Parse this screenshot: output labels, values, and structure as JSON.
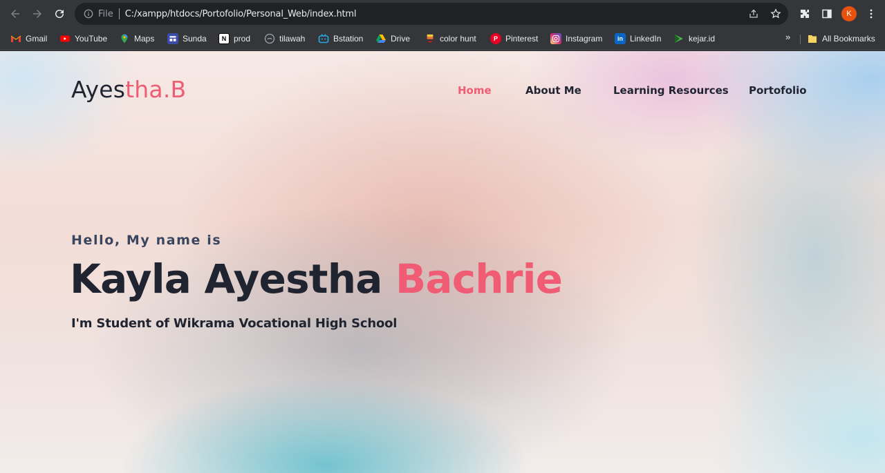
{
  "browser": {
    "omnibox": {
      "scheme_label": "File",
      "url": "C:/xampp/htdocs/Portofolio/Personal_Web/index.html"
    },
    "profile_initial": "K",
    "bookmarks": [
      {
        "label": "Gmail",
        "icon": "gmail-icon",
        "color": "#ea4335"
      },
      {
        "label": "YouTube",
        "icon": "youtube-icon",
        "color": "#ff0000"
      },
      {
        "label": "Maps",
        "icon": "maps-icon",
        "color": "#34a853"
      },
      {
        "label": "Sunda",
        "icon": "sunda-icon",
        "color": "#3b4ba8"
      },
      {
        "label": "prod",
        "icon": "notion-icon",
        "color": "#ffffff"
      },
      {
        "label": "tilawah",
        "icon": "tilawah-icon",
        "color": "#7a8a99"
      },
      {
        "label": "Bstation",
        "icon": "bstation-icon",
        "color": "#23ade5"
      },
      {
        "label": "Drive",
        "icon": "drive-icon",
        "color": "#fbbc04"
      },
      {
        "label": "color hunt",
        "icon": "colorhunt-icon",
        "color": "#f6c343"
      },
      {
        "label": "Pinterest",
        "icon": "pinterest-icon",
        "color": "#e60023"
      },
      {
        "label": "Instagram",
        "icon": "instagram-icon",
        "color": "#d62976"
      },
      {
        "label": "LinkedIn",
        "icon": "linkedin-icon",
        "color": "#0a66c2"
      },
      {
        "label": "kejar.id",
        "icon": "kejar-icon",
        "color": "#4caf50"
      }
    ],
    "more_bookmarks": "»",
    "all_bookmarks": "All Bookmarks"
  },
  "site": {
    "logo": {
      "part1": "Ayes",
      "part2": "tha.B"
    },
    "nav": [
      {
        "label": "Home",
        "active": true
      },
      {
        "label": "About Me",
        "active": false
      },
      {
        "label": "Learning Resources",
        "active": false
      },
      {
        "label": "Portofolio",
        "active": false
      }
    ],
    "hero": {
      "greeting": "Hello, My name is",
      "name_main": "Kayla Ayestha ",
      "name_accent": "Bachrie",
      "subtitle": "I'm Student of Wikrama Vocational High School"
    },
    "colors": {
      "accent": "#ef5c74",
      "text": "#1f2430"
    }
  }
}
